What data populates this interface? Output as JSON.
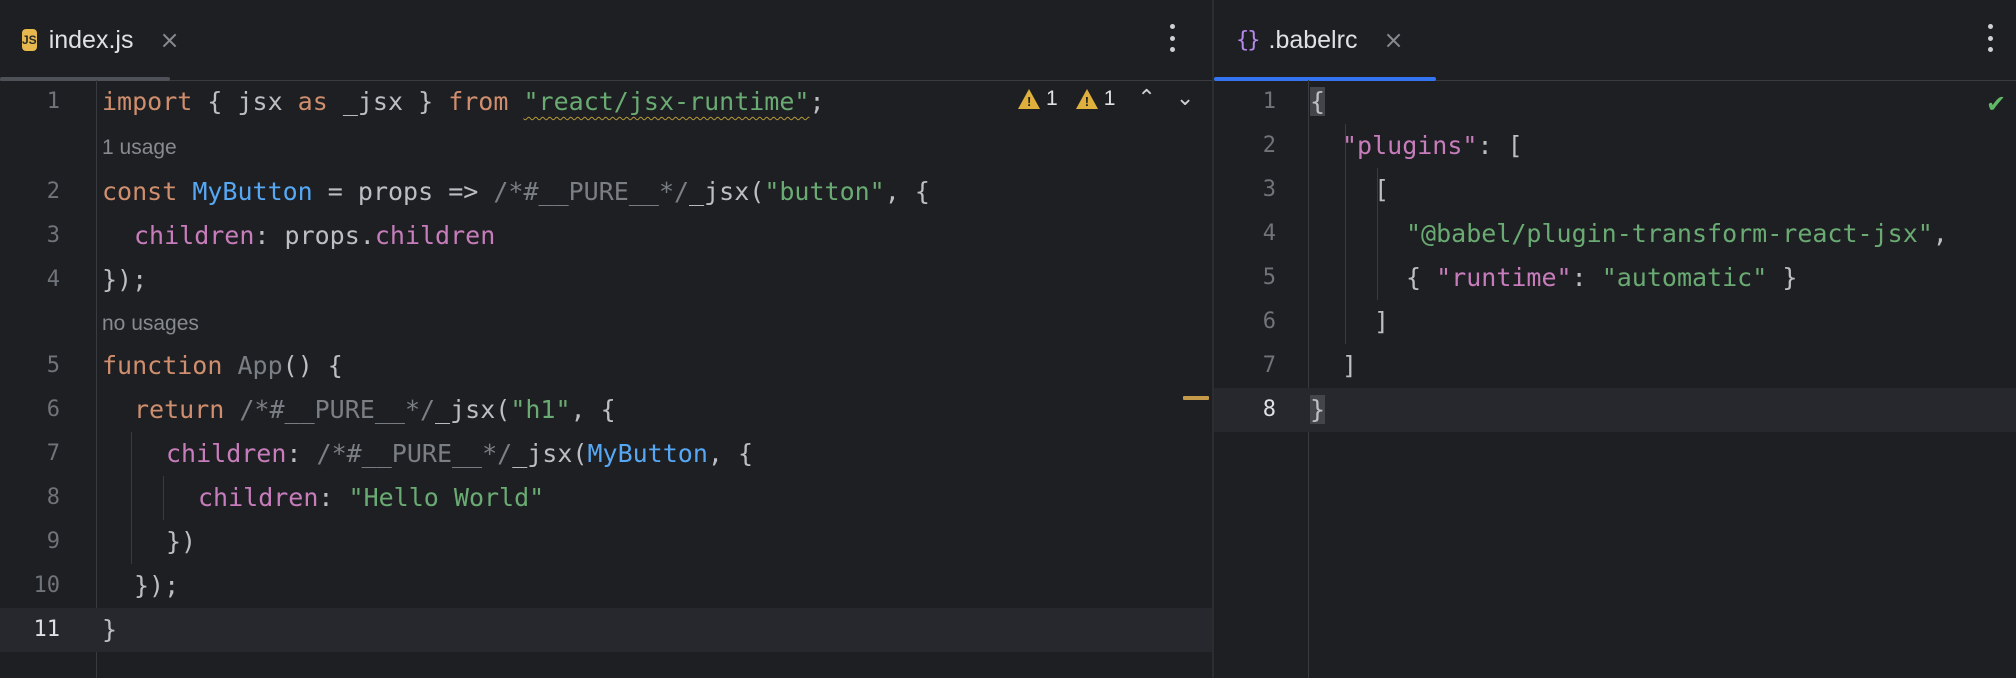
{
  "left_tab": {
    "icon": "js-file-icon",
    "icon_text": "JS",
    "label": "index.js",
    "close": "×"
  },
  "right_tab": {
    "icon": "json-braces-icon",
    "icon_text": "{}",
    "label": ".babelrc",
    "close": "×"
  },
  "inspection": {
    "warnings_count": "1",
    "weak_warnings_count": "1"
  },
  "left_editor": {
    "line_numbers": [
      "1",
      "2",
      "3",
      "4",
      "5",
      "6",
      "7",
      "8",
      "9",
      "10",
      "11"
    ],
    "current_line": "11",
    "hints": [
      "1 usage",
      "no usages"
    ],
    "code": {
      "l1": [
        "import",
        " { jsx ",
        "as",
        " _jsx } ",
        "from",
        " ",
        "\"react/jsx-runtime\"",
        ";"
      ],
      "l2": [
        "const",
        " ",
        "MyButton",
        " = props => ",
        "/*#__PURE__*/",
        "_jsx(",
        "\"button\"",
        ", {"
      ],
      "l3": [
        "children",
        ": props.",
        "children"
      ],
      "l4": [
        "});"
      ],
      "l5": [
        "function",
        " ",
        "App",
        "() {"
      ],
      "l6": [
        "return",
        " ",
        "/*#__PURE__*/",
        "_jsx(",
        "\"h1\"",
        ", {"
      ],
      "l7": [
        "children",
        ": ",
        "/*#__PURE__*/",
        "_jsx(",
        "MyButton",
        ", {"
      ],
      "l8": [
        "children",
        ": ",
        "\"Hello World\""
      ],
      "l9": [
        "})"
      ],
      "l10": [
        "});"
      ],
      "l11": [
        "}"
      ]
    }
  },
  "right_editor": {
    "line_numbers": [
      "1",
      "2",
      "3",
      "4",
      "5",
      "6",
      "7",
      "8"
    ],
    "current_line": "8",
    "code": {
      "l1": [
        "{"
      ],
      "l2": [
        "\"plugins\"",
        ": ["
      ],
      "l3": [
        "["
      ],
      "l4": [
        "\"@babel/plugin-transform-react-jsx\"",
        ","
      ],
      "l5": [
        "{ ",
        "\"runtime\"",
        ": ",
        "\"automatic\"",
        " }"
      ],
      "l6": [
        "]"
      ],
      "l7": [
        "]"
      ],
      "l8": [
        "}"
      ]
    }
  },
  "colors": {
    "background": "#1e1f22",
    "keyword": "#cf8e6d",
    "string": "#6aab73",
    "function": "#56a8f5",
    "property": "#c77dbb",
    "comment": "#7a7e85",
    "accent": "#3574f0"
  }
}
